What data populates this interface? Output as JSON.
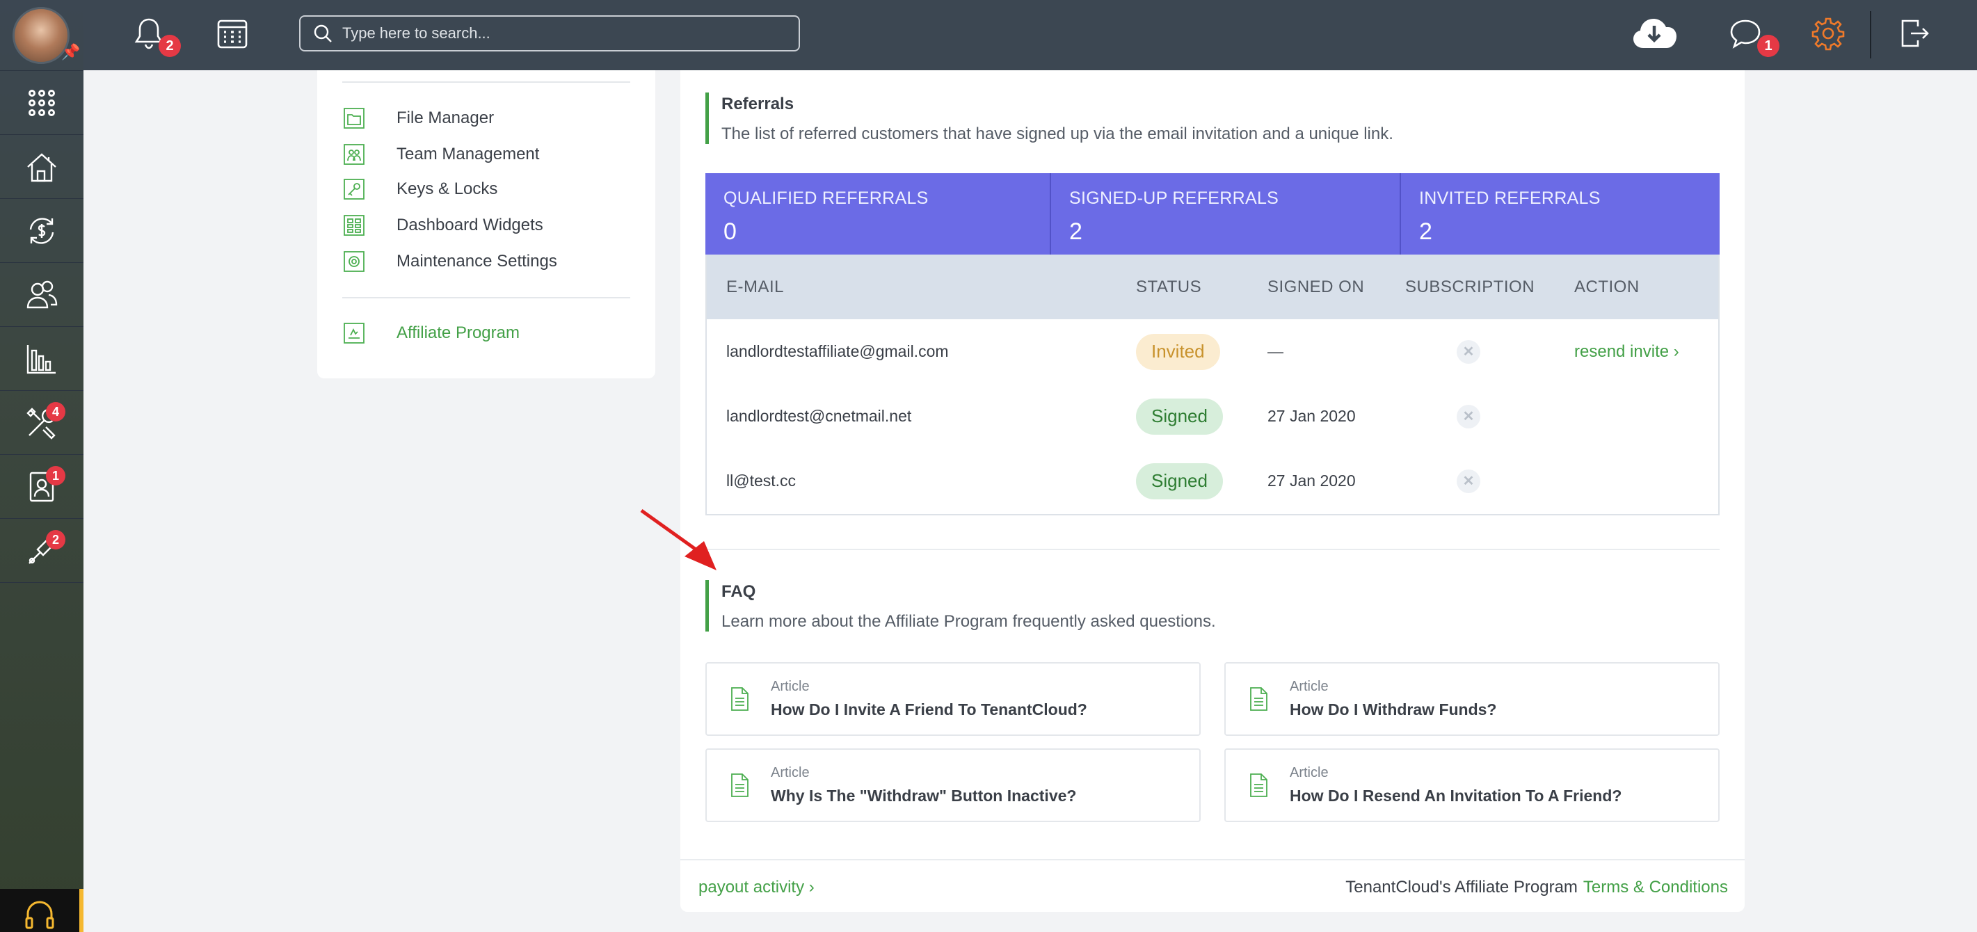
{
  "search": {
    "placeholder": "Type here to search..."
  },
  "topbar": {
    "notifications_count": "2",
    "messages_count": "1"
  },
  "sidebar": {
    "items": [
      {
        "icon": "apps-grid-icon",
        "badge": ""
      },
      {
        "icon": "properties-house-icon",
        "badge": ""
      },
      {
        "icon": "payments-cycle-icon",
        "badge": ""
      },
      {
        "icon": "people-icon",
        "badge": ""
      },
      {
        "icon": "reports-chart-icon",
        "badge": ""
      },
      {
        "icon": "maintenance-tools-icon",
        "badge": "4"
      },
      {
        "icon": "applications-icon",
        "badge": "1"
      },
      {
        "icon": "services-icon",
        "badge": "2"
      }
    ]
  },
  "settings_menu": {
    "items": [
      {
        "label": "File Manager",
        "icon": "folder-icon"
      },
      {
        "label": "Team Management",
        "icon": "team-icon"
      },
      {
        "label": "Keys & Locks",
        "icon": "key-icon"
      },
      {
        "label": "Dashboard Widgets",
        "icon": "widgets-icon"
      },
      {
        "label": "Maintenance Settings",
        "icon": "gear-icon"
      }
    ],
    "active_item": {
      "label": "Affiliate Program",
      "icon": "affiliate-icon"
    }
  },
  "referrals": {
    "title": "Referrals",
    "description": "The list of referred customers that have signed up via the email invitation and a unique link.",
    "stats": [
      {
        "label": "QUALIFIED REFERRALS",
        "value": "0"
      },
      {
        "label": "SIGNED-UP REFERRALS",
        "value": "2"
      },
      {
        "label": "INVITED REFERRALS",
        "value": "2"
      }
    ],
    "columns": [
      "E-MAIL",
      "STATUS",
      "SIGNED ON",
      "SUBSCRIPTION",
      "ACTION"
    ],
    "rows": [
      {
        "email": "landlordtestaffiliate@gmail.com",
        "status": "Invited",
        "signed_on": "—",
        "action": "resend invite"
      },
      {
        "email": "landlordtest@cnetmail.net",
        "status": "Signed",
        "signed_on": "27 Jan 2020",
        "action": ""
      },
      {
        "email": "ll@test.cc",
        "status": "Signed",
        "signed_on": "27 Jan 2020",
        "action": ""
      }
    ]
  },
  "faq": {
    "title": "FAQ",
    "description": "Learn more about the Affiliate Program frequently asked questions.",
    "articles": [
      {
        "kind": "Article",
        "title": "How Do I Invite A Friend To TenantCloud?"
      },
      {
        "kind": "Article",
        "title": "How Do I Withdraw Funds?"
      },
      {
        "kind": "Article",
        "title": "Why Is The \"Withdraw\" Button Inactive?"
      },
      {
        "kind": "Article",
        "title": "How Do I Resend An Invitation To A Friend?"
      }
    ]
  },
  "footer": {
    "payout_link": "payout activity",
    "program_text": "TenantCloud's Affiliate Program",
    "terms_link": "Terms & Conditions"
  },
  "colors": {
    "accent_green": "#43a047",
    "stats_purple": "#6b6be6",
    "badge_red": "#e53945"
  }
}
